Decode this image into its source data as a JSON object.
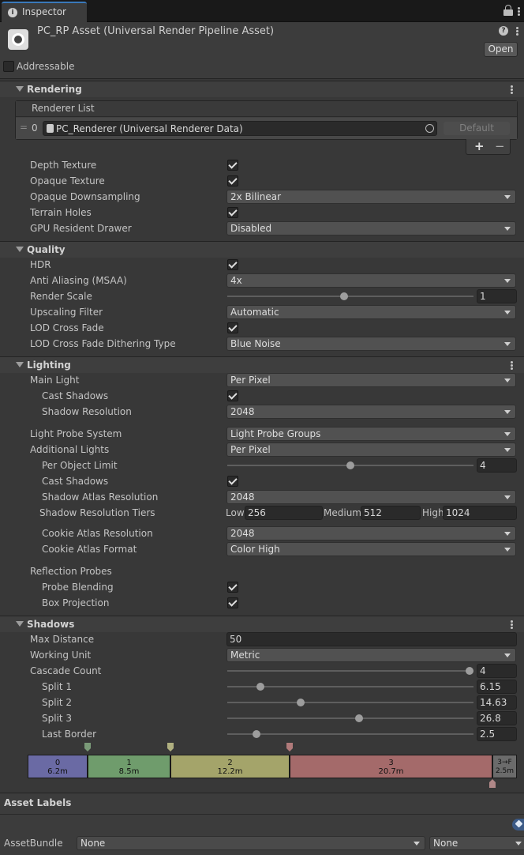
{
  "tab": {
    "label": "Inspector"
  },
  "header": {
    "title": "PC_RP Asset (Universal Render Pipeline Asset)",
    "open_label": "Open",
    "addressable_label": "Addressable",
    "help_icon": "help-icon",
    "lock_icon": "lock-icon"
  },
  "rendering": {
    "title": "Rendering",
    "renderer_list": {
      "label": "Renderer List",
      "index": "0",
      "renderer": "PC_Renderer (Universal Renderer Data)",
      "default_label": "Default",
      "add": "+",
      "remove": "−"
    },
    "rows": [
      {
        "label": "Depth Texture",
        "type": "check",
        "checked": true
      },
      {
        "label": "Opaque Texture",
        "type": "check",
        "checked": true
      },
      {
        "label": "Opaque Downsampling",
        "type": "dropdown",
        "value": "2x Bilinear"
      },
      {
        "label": "Terrain Holes",
        "type": "check",
        "checked": true
      },
      {
        "label": "GPU Resident Drawer",
        "type": "dropdown",
        "value": "Disabled"
      }
    ]
  },
  "quality": {
    "title": "Quality",
    "rows": [
      {
        "label": "HDR",
        "type": "check",
        "checked": true
      },
      {
        "label": "Anti Aliasing (MSAA)",
        "type": "dropdown",
        "value": "4x"
      },
      {
        "label": "Render Scale",
        "type": "slider",
        "value": "1",
        "level": 0.47
      },
      {
        "label": "Upscaling Filter",
        "type": "dropdown",
        "value": "Automatic"
      },
      {
        "label": "LOD Cross Fade",
        "type": "check",
        "checked": true
      },
      {
        "label": "LOD Cross Fade Dithering Type",
        "type": "dropdown",
        "value": "Blue Noise"
      }
    ]
  },
  "lighting": {
    "title": "Lighting",
    "main_light": {
      "label": "Main Light",
      "value": "Per Pixel"
    },
    "cast_shadows": {
      "label": "Cast Shadows",
      "checked": true
    },
    "shadow_resolution": {
      "label": "Shadow Resolution",
      "value": "2048"
    },
    "light_probe_system": {
      "label": "Light Probe System",
      "value": "Light Probe Groups"
    },
    "additional_lights": {
      "label": "Additional Lights",
      "value": "Per Pixel"
    },
    "per_object_limit": {
      "label": "Per Object Limit",
      "value": "4",
      "level": 0.5
    },
    "add_cast_shadows": {
      "label": "Cast Shadows",
      "checked": true
    },
    "shadow_atlas_resolution": {
      "label": "Shadow Atlas Resolution",
      "value": "2048"
    },
    "shadow_resolution_tiers": {
      "label": "Shadow Resolution Tiers",
      "low_label": "Low",
      "low": "256",
      "medium_label": "Medium",
      "medium": "512",
      "high_label": "High",
      "high": "1024"
    },
    "cookie_atlas_resolution": {
      "label": "Cookie Atlas Resolution",
      "value": "2048"
    },
    "cookie_atlas_format": {
      "label": "Cookie Atlas Format",
      "value": "Color High"
    },
    "reflection_probes": {
      "label": "Reflection Probes"
    },
    "probe_blending": {
      "label": "Probe Blending",
      "checked": true
    },
    "box_projection": {
      "label": "Box Projection",
      "checked": true
    }
  },
  "shadows": {
    "title": "Shadows",
    "max_distance": {
      "label": "Max Distance",
      "value": "50"
    },
    "working_unit": {
      "label": "Working Unit",
      "value": "Metric"
    },
    "cascade_count": {
      "label": "Cascade Count",
      "value": "4",
      "level": 1.0
    },
    "splits": [
      {
        "label": "Split 1",
        "value": "6.15",
        "level": 0.13
      },
      {
        "label": "Split 2",
        "value": "14.63",
        "level": 0.29
      },
      {
        "label": "Split 3",
        "value": "26.8",
        "level": 0.54
      },
      {
        "label": "Last Border",
        "value": "2.5",
        "level": 0.12
      }
    ],
    "cascades": [
      {
        "name": "0",
        "dist": "6.2m",
        "color": "#6a6aa4",
        "frac": 0.123
      },
      {
        "name": "1",
        "dist": "8.5m",
        "color": "#6f9c6c",
        "frac": 0.17
      },
      {
        "name": "2",
        "dist": "12.2m",
        "color": "#a4a46a",
        "frac": 0.244
      },
      {
        "name": "3",
        "dist": "20.7m",
        "color": "#a46a6a",
        "frac": 0.414
      },
      {
        "name": "3→F",
        "dist": "2.5m",
        "color": "#6b6b6b",
        "frac": 0.049
      }
    ]
  },
  "asset_labels": {
    "title": "Asset Labels",
    "assetbundle_label": "AssetBundle",
    "bundle_value": "None",
    "variant_value": "None",
    "tag_icon": "tag-icon"
  },
  "colors": {
    "accent": "#3a79bb",
    "panel": "#383838"
  }
}
